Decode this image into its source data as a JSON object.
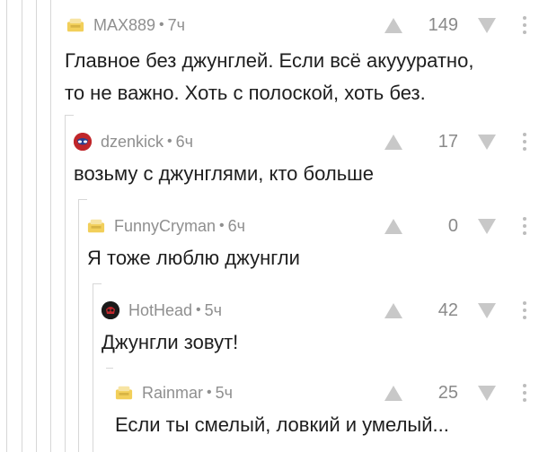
{
  "comments": [
    {
      "username": "MAX889",
      "time": "7ч",
      "rating": "149",
      "text": "Главное без джунглей. Если всё акуууратно,\nто не важно. Хоть с полоской, хоть без.",
      "avatar": "default-avatar-icon"
    },
    {
      "username": "dzenkick",
      "time": "6ч",
      "rating": "17",
      "text": "возьму с джунглями, кто больше",
      "avatar": "spiderman-avatar"
    },
    {
      "username": "FunnyCryman",
      "time": "6ч",
      "rating": "0",
      "text": "Я тоже люблю джунгли",
      "avatar": "default-avatar-icon"
    },
    {
      "username": "HotHead",
      "time": "5ч",
      "rating": "42",
      "text": "Джунгли зовут!",
      "avatar": "skull-avatar"
    },
    {
      "username": "Rainmar",
      "time": "5ч",
      "rating": "25",
      "text": "Если ты смелый, ловкий и умелый...",
      "avatar": "default-avatar-icon"
    }
  ],
  "separator": "•",
  "colors": {
    "meta": "#8f8f8f",
    "text": "#1e1e1e",
    "vote_arrow": "#c8c8c8",
    "thread_line": "#d7d7d7"
  }
}
